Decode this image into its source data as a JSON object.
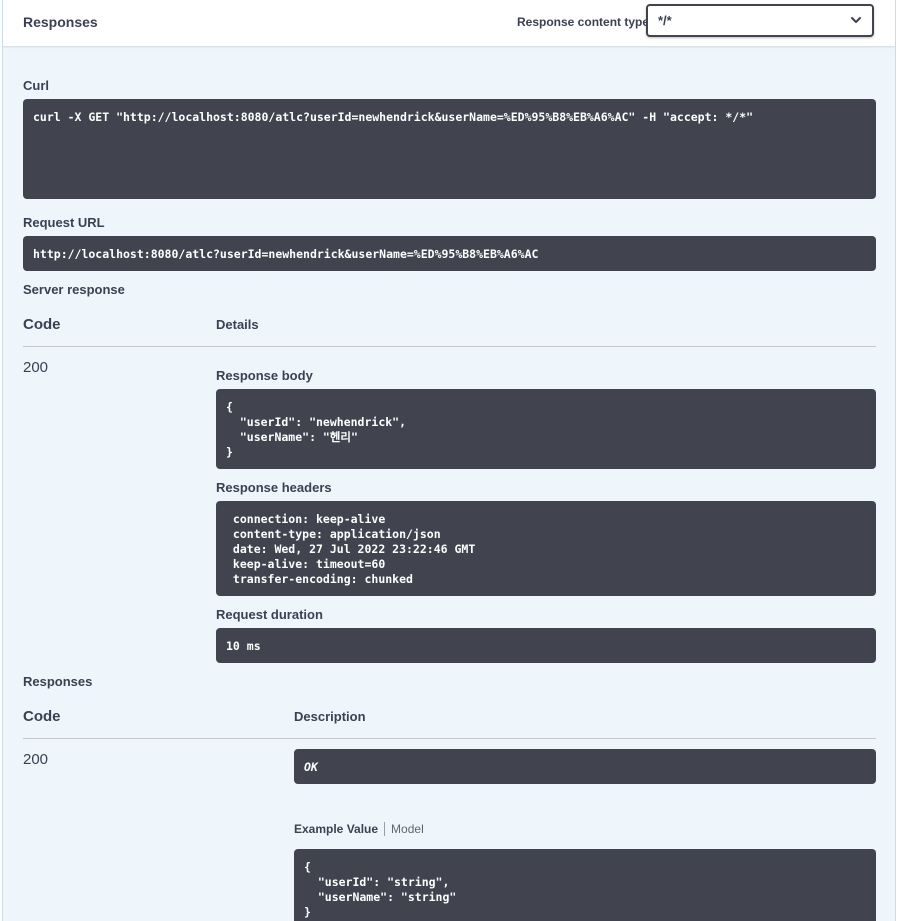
{
  "header": {
    "title": "Responses",
    "content_type_label": "Response content type",
    "content_type_value": "*/*"
  },
  "curl": {
    "label": "Curl",
    "command": "curl -X GET \"http://localhost:8080/atlc?userId=newhendrick&userName=%ED%95%B8%EB%A6%AC\" -H \"accept: */*\""
  },
  "request_url": {
    "label": "Request URL",
    "value": "http://localhost:8080/atlc?userId=newhendrick&userName=%ED%95%B8%EB%A6%AC"
  },
  "server_response": {
    "label": "Server response",
    "code_header": "Code",
    "details_header": "Details",
    "code": "200",
    "body_label": "Response body",
    "body": "{\n  \"userId\": \"newhendrick\",\n  \"userName\": \"헨리\"\n}",
    "headers_label": "Response headers",
    "headers": " connection: keep-alive\n content-type: application/json\n date: Wed, 27 Jul 2022 23:22:46 GMT\n keep-alive: timeout=60\n transfer-encoding: chunked",
    "duration_label": "Request duration",
    "duration": "10 ms"
  },
  "responses": {
    "label": "Responses",
    "code_header": "Code",
    "description_header": "Description",
    "code": "200",
    "description": "OK",
    "tab_example": "Example Value",
    "tab_model": "Model",
    "example": "{\n  \"userId\": \"string\",\n  \"userName\": \"string\"\n}"
  },
  "colors": {
    "panel_bg": "#eef6fc",
    "code_bg": "#41444e",
    "text": "#3b4151"
  },
  "icons": {
    "select": "chevron-down-icon"
  }
}
